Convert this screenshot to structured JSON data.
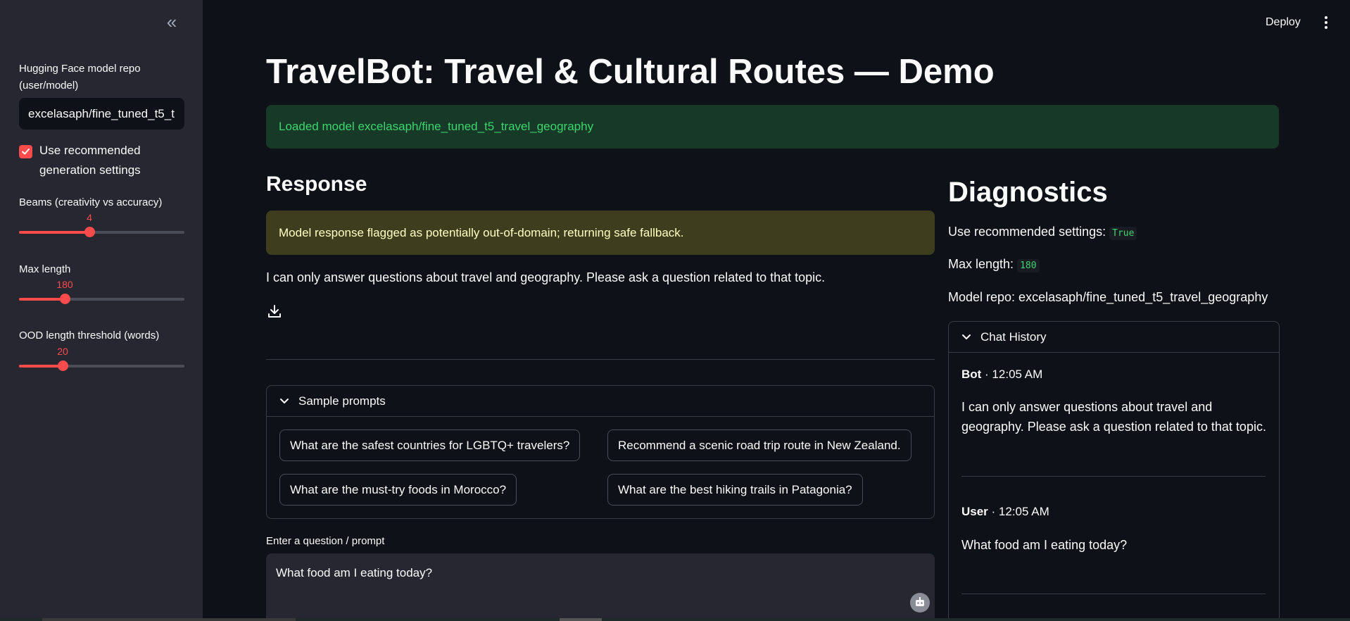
{
  "sidebar": {
    "model_repo_label": "Hugging Face model repo (user/model)",
    "model_repo_value": "excelasaph/fine_tuned_t5_t",
    "use_recommended_label": "Use recommended generation settings",
    "use_recommended_checked": true,
    "sliders": [
      {
        "label": "Beams (creativity vs accuracy)",
        "value": "4",
        "fraction": 0.425
      },
      {
        "label": "Max length",
        "value": "180",
        "fraction": 0.275
      },
      {
        "label": "OOD length threshold (words)",
        "value": "20",
        "fraction": 0.265
      }
    ]
  },
  "header": {
    "deploy_label": "Deploy"
  },
  "main": {
    "title": "TravelBot: Travel & Cultural Routes — Demo",
    "success_message": "Loaded model excelasaph/fine_tuned_t5_travel_geography",
    "response_heading": "Response",
    "warning_message": "Model response flagged as potentially out-of-domain; returning safe fallback.",
    "response_text": "I can only answer questions about travel and geography. Please ask a question related to that topic.",
    "sample_prompts": {
      "label": "Sample prompts",
      "items": [
        "What are the safest countries for LGBTQ+ travelers?",
        "Recommend a scenic road trip route in New Zealand.",
        "What are the must-try foods in Morocco?",
        "What are the best hiking trails in Patagonia?"
      ]
    },
    "input_label": "Enter a question / prompt",
    "input_value": "What food am I eating today?"
  },
  "diagnostics": {
    "heading": "Diagnostics",
    "use_recommended_label": "Use recommended settings:",
    "use_recommended_value": "True",
    "max_length_label": "Max length:",
    "max_length_value": "180",
    "model_repo_line": "Model repo: excelasaph/fine_tuned_t5_travel_geography",
    "chat_history": {
      "label": "Chat History",
      "messages": [
        {
          "sender": "Bot",
          "time": " · 12:05 AM",
          "text": "I can only answer questions about travel and geography. Please ask a question related to that topic."
        },
        {
          "sender": "User",
          "time": " · 12:05 AM",
          "text": "What food am I eating today?"
        }
      ]
    }
  },
  "colors": {
    "accent": "#ff4b4b",
    "success_bg": "#173928",
    "success_text": "#3dd56d",
    "warning_bg": "#3e3d1e",
    "warning_text": "#ffffc2"
  }
}
